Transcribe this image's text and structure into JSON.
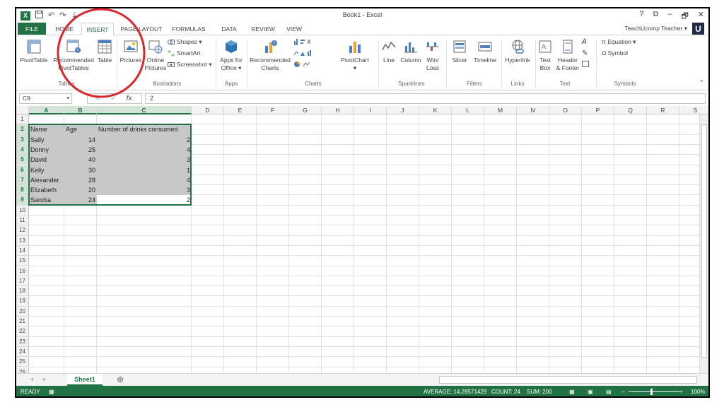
{
  "window": {
    "title": "Book1 - Excel",
    "controls": [
      "?",
      "⧉",
      "–",
      "🗗",
      "✕"
    ]
  },
  "qat": {
    "undo": "↶",
    "redo": "↷",
    "customize": "⇣"
  },
  "app_logo": "X",
  "account": {
    "user": "TeachUcomp Teacher ▾",
    "logo": "U"
  },
  "tabs": [
    "FILE",
    "HOME",
    "INSERT",
    "PAGE LAYOUT",
    "FORMULAS",
    "DATA",
    "REVIEW",
    "VIEW"
  ],
  "ribbon": {
    "tables": {
      "pivottable": "PivotTable",
      "recommended": "Recommended",
      "pivottables": "PivotTables",
      "table": "Table",
      "label": "Tables"
    },
    "illustrations": {
      "pictures": "Pictures",
      "online1": "Online",
      "online2": "Pictures",
      "shapes": "Shapes ▾",
      "smartart": "SmartArt",
      "screenshot": "Screenshot ▾",
      "label": "Illustrations"
    },
    "apps": {
      "apps1": "Apps for",
      "apps2": "Office ▾",
      "label": "Apps"
    },
    "charts": {
      "rec1": "Recommended",
      "rec2": "Charts",
      "pivotchart": "PivotChart",
      "pivotchart_arrow": "▾",
      "label": "Charts"
    },
    "sparklines": {
      "line": "Line",
      "column": "Column",
      "winloss1": "Win/",
      "winloss2": "Loss",
      "label": "Sparklines"
    },
    "filters": {
      "slicer": "Slicer",
      "timeline": "Timeline",
      "label": "Filters"
    },
    "links": {
      "hyperlink": "Hyperlink",
      "label": "Links"
    },
    "text": {
      "textbox1": "Text",
      "textbox2": "Box",
      "hf1": "Header",
      "hf2": "& Footer",
      "label": "Text"
    },
    "symbols": {
      "equation": "π Equation ▾",
      "symbol": "Ω Symbol",
      "label": "Symbols"
    }
  },
  "formula_bar": {
    "name_box": "C9",
    "fx": "fx",
    "cancel": "✕",
    "enter": "✓",
    "value": "2"
  },
  "columns": [
    "A",
    "B",
    "C",
    "D",
    "E",
    "F",
    "G",
    "H",
    "I",
    "J",
    "K",
    "L",
    "M",
    "N",
    "O",
    "P",
    "Q",
    "R",
    "S"
  ],
  "rows": [
    "1",
    "2",
    "3",
    "4",
    "5",
    "6",
    "7",
    "8",
    "9",
    "10",
    "11",
    "12",
    "13",
    "14",
    "15",
    "16",
    "17",
    "18",
    "19",
    "20",
    "21",
    "22",
    "23",
    "24",
    "25",
    "26"
  ],
  "table": {
    "headers": [
      "Name",
      "Age",
      "Number of drinks consumed"
    ],
    "data": [
      [
        "Sally",
        "14",
        "2"
      ],
      [
        "Donny",
        "25",
        "4"
      ],
      [
        "David",
        "40",
        "3"
      ],
      [
        "Kelly",
        "30",
        "1"
      ],
      [
        "Alexander",
        "28",
        "4"
      ],
      [
        "Elizabeth",
        "20",
        "3"
      ],
      [
        "Sandra",
        "24",
        "2"
      ]
    ]
  },
  "sheets": {
    "active": "Sheet1",
    "add": "⊕"
  },
  "status": {
    "ready": "READY",
    "average": "AVERAGE: 14.28571429",
    "count": "COUNT: 24",
    "sum": "SUM: 200",
    "zoom": "100%"
  },
  "colors": {
    "excel_green": "#217346",
    "selection_gray": "#c8c8c8",
    "annotation_red": "#d9262b"
  }
}
